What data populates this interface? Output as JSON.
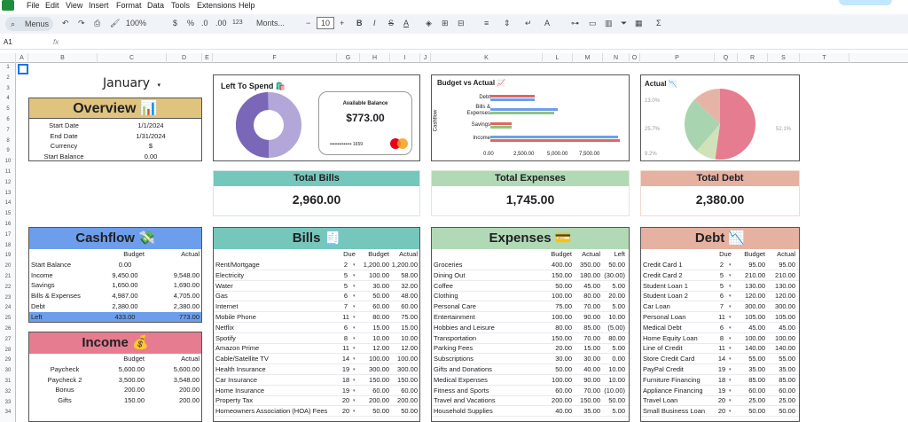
{
  "menu": {
    "items": [
      "File",
      "Edit",
      "View",
      "Insert",
      "Format",
      "Data",
      "Tools",
      "Extensions",
      "Help"
    ]
  },
  "toolbar": {
    "search": "Menus",
    "zoom": "100%",
    "font": "Monts...",
    "size": "10",
    "dollar": "$",
    "pct": "%",
    "dec1": ".0",
    "dec2": ".00",
    "num": "123"
  },
  "formula": {
    "ref": "A1",
    "fx": "fx"
  },
  "cols": [
    "A",
    "B",
    "C",
    "D",
    "E",
    "F",
    "G",
    "H",
    "I",
    "J",
    "K",
    "L",
    "M",
    "N",
    "O",
    "P",
    "Q",
    "R",
    "S",
    "T"
  ],
  "rows": [
    "1",
    "2",
    "3",
    "4",
    "5",
    "6",
    "7",
    "8",
    "9",
    "10",
    "11",
    "12",
    "13",
    "14",
    "15",
    "16",
    "17",
    "18",
    "19",
    "20",
    "21",
    "22",
    "23",
    "24",
    "25",
    "26",
    "27",
    "28",
    "29",
    "30",
    "31",
    "32",
    "33",
    "34"
  ],
  "month": "January",
  "overview": {
    "title": "Overview 📊",
    "rows": [
      [
        "Start Date",
        "1/1/2024"
      ],
      [
        "End Date",
        "1/31/2024"
      ],
      [
        "Currency",
        "$"
      ],
      [
        "Start Balance",
        "0.00"
      ]
    ]
  },
  "lts": {
    "title": "Left To Spend 🛍️",
    "avail": "Available Balance",
    "amount": "$773.00",
    "cardnum": "•••••••••••••• 1659",
    "brand": "MasterCard"
  },
  "bva": {
    "title": "Budget vs Actual 📈",
    "ylabel": "Cashflow",
    "cats": [
      "Debt",
      "Bills & Expenses",
      "Savings",
      "Income"
    ],
    "xticks": [
      "0.00",
      "2,500.00",
      "5,000.00",
      "7,500.00"
    ]
  },
  "actual": {
    "title": "Actual 📉",
    "labels": [
      "13.0%",
      "25.7%",
      "9.2%",
      "52.1%"
    ]
  },
  "totals": [
    {
      "label": "Total Bills",
      "value": "2,960.00"
    },
    {
      "label": "Total Expenses",
      "value": "1,745.00"
    },
    {
      "label": "Total Debt",
      "value": "2,380.00"
    }
  ],
  "cashflow": {
    "title": "Cashflow 💸",
    "h1": "Budget",
    "h2": "Actual",
    "rows": [
      [
        "Start Balance",
        "0.00",
        ""
      ],
      [
        "Income",
        "9,450.00",
        "9,548.00"
      ],
      [
        "Savings",
        "1,650.00",
        "1,690.00"
      ],
      [
        "Bills & Expenses",
        "4,987.00",
        "4,705.00"
      ],
      [
        "Debt",
        "2,380.00",
        "2,380.00"
      ],
      [
        "Left",
        "433.00",
        "773.00"
      ]
    ]
  },
  "income": {
    "title": "Income 💰",
    "h1": "Budget",
    "h2": "Actual",
    "rows": [
      [
        "Paycheck",
        "5,600.00",
        "5,600.00"
      ],
      [
        "Paycheck 2",
        "3,500.00",
        "3,548.00"
      ],
      [
        "Bonus",
        "200.00",
        "200.00"
      ],
      [
        "Gifts",
        "150.00",
        "200.00"
      ]
    ]
  },
  "bills": {
    "title": "Bills 🧾",
    "h0": "Due",
    "h1": "Budget",
    "h2": "Actual",
    "rows": [
      [
        "Rent/Mortgage",
        "2",
        "1,200.00",
        "1,200.00"
      ],
      [
        "Electricity",
        "5",
        "100.00",
        "58.00"
      ],
      [
        "Water",
        "5",
        "30.00",
        "32.00"
      ],
      [
        "Gas",
        "6",
        "50.00",
        "48.00"
      ],
      [
        "Internet",
        "7",
        "60.00",
        "60.00"
      ],
      [
        "Mobile Phone",
        "11",
        "80.00",
        "75.00"
      ],
      [
        "Netflix",
        "6",
        "15.00",
        "15.00"
      ],
      [
        "Spotify",
        "8",
        "10.00",
        "10.00"
      ],
      [
        "Amazon Prime",
        "11",
        "12.00",
        "12.00"
      ],
      [
        "Cable/Satellite TV",
        "14",
        "100.00",
        "100.00"
      ],
      [
        "Health Insurance",
        "19",
        "300.00",
        "300.00"
      ],
      [
        "Car Insurance",
        "18",
        "150.00",
        "150.00"
      ],
      [
        "Home Insurance",
        "19",
        "60.00",
        "60.00"
      ],
      [
        "Property Tax",
        "20",
        "200.00",
        "200.00"
      ],
      [
        "Homeowners Association (HOA) Fees",
        "20",
        "50.00",
        "50.00"
      ]
    ]
  },
  "expenses": {
    "title": "Expenses 💳",
    "h1": "Budget",
    "h2": "Actual",
    "h3": "Left",
    "rows": [
      [
        "Groceries",
        "400.00",
        "350.00",
        "50.00"
      ],
      [
        "Dining Out",
        "150.00",
        "180.00",
        "(30.00)"
      ],
      [
        "Coffee",
        "50.00",
        "45.00",
        "5.00"
      ],
      [
        "Clothing",
        "100.00",
        "80.00",
        "20.00"
      ],
      [
        "Personal Care",
        "75.00",
        "70.00",
        "5.00"
      ],
      [
        "Entertainment",
        "100.00",
        "90.00",
        "10.00"
      ],
      [
        "Hobbies and Leisure",
        "80.00",
        "85.00",
        "(5.00)"
      ],
      [
        "Transportation",
        "150.00",
        "70.00",
        "80.00"
      ],
      [
        "Parking Fees",
        "20.00",
        "15.00",
        "5.00"
      ],
      [
        "Subscriptions",
        "30.00",
        "30.00",
        "0.00"
      ],
      [
        "Gifts and Donations",
        "50.00",
        "40.00",
        "10.00"
      ],
      [
        "Medical Expenses",
        "100.00",
        "90.00",
        "10.00"
      ],
      [
        "Fitness and Sports",
        "60.00",
        "70.00",
        "(10.00)"
      ],
      [
        "Travel and Vacations",
        "200.00",
        "150.00",
        "50.00"
      ],
      [
        "Household Supplies",
        "40.00",
        "35.00",
        "5.00"
      ]
    ]
  },
  "debt": {
    "title": "Debt 📉",
    "h0": "Due",
    "h1": "Budget",
    "h2": "Actual",
    "rows": [
      [
        "Credit Card 1",
        "2",
        "95.00",
        "95.00"
      ],
      [
        "Credit Card 2",
        "5",
        "210.00",
        "210.00"
      ],
      [
        "Student Loan 1",
        "5",
        "130.00",
        "130.00"
      ],
      [
        "Student Loan 2",
        "6",
        "120.00",
        "120.00"
      ],
      [
        "Car Loan",
        "7",
        "300.00",
        "300.00"
      ],
      [
        "Personal Loan",
        "11",
        "105.00",
        "105.00"
      ],
      [
        "Medical Debt",
        "6",
        "45.00",
        "45.00"
      ],
      [
        "Home Equity Loan",
        "8",
        "100.00",
        "100.00"
      ],
      [
        "Line of Credit",
        "11",
        "140.00",
        "140.00"
      ],
      [
        "Store Credit Card",
        "14",
        "55.00",
        "55.00"
      ],
      [
        "PayPal Credit",
        "19",
        "35.00",
        "35.00"
      ],
      [
        "Furniture Financing",
        "18",
        "85.00",
        "85.00"
      ],
      [
        "Appliance Financing",
        "19",
        "60.00",
        "60.00"
      ],
      [
        "Travel Loan",
        "20",
        "25.00",
        "25.00"
      ],
      [
        "Small Business Loan",
        "20",
        "50.00",
        "50.00"
      ]
    ]
  }
}
